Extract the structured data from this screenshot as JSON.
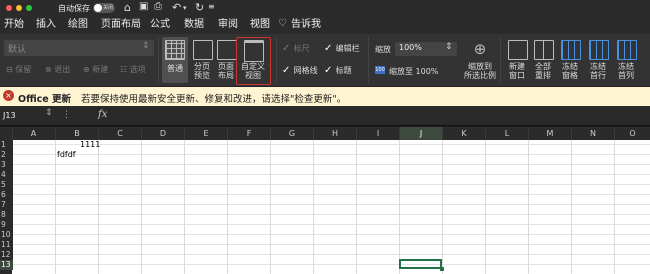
{
  "titlebar": {
    "autosave_label": "自动保存",
    "autosave_toggle_text": "关闭"
  },
  "menu": {
    "items": [
      "开始",
      "插入",
      "绘图",
      "页面布局",
      "公式",
      "数据",
      "审阅",
      "视图"
    ],
    "active": "视图",
    "tell_me": "告诉我"
  },
  "ribbon": {
    "sheet_view_select": "默认",
    "sheet_view_buttons": [
      "保留",
      "退出",
      "新建",
      "选项"
    ],
    "views": [
      {
        "label1": "普通",
        "label2": ""
      },
      {
        "label1": "分页",
        "label2": "预览"
      },
      {
        "label1": "页面",
        "label2": "布局"
      },
      {
        "label1": "自定义",
        "label2": "视图"
      }
    ],
    "show": [
      {
        "label": "标尺",
        "checked": true,
        "enabled": false
      },
      {
        "label": "编辑栏",
        "checked": true,
        "enabled": true
      },
      {
        "label": "网格线",
        "checked": true,
        "enabled": true
      },
      {
        "label": "标题",
        "checked": true,
        "enabled": true
      }
    ],
    "zoom_label": "缩放",
    "zoom_value": "100%",
    "zoom_100_label": "缩放至 100%",
    "zoom_to_selection": {
      "label1": "缩放到",
      "label2": "所选比例"
    },
    "window_buttons": [
      {
        "label1": "新建",
        "label2": "窗口"
      },
      {
        "label1": "全部",
        "label2": "重排"
      },
      {
        "label1": "冻结",
        "label2": "窗格"
      },
      {
        "label1": "冻结",
        "label2": "首行"
      },
      {
        "label1": "冻结",
        "label2": "首列"
      }
    ]
  },
  "message_bar": {
    "title": "Office 更新",
    "text": "若要保持使用最新安全更新、修复和改进，请选择\"检查更新\"。"
  },
  "formula_bar": {
    "name_box": "J13",
    "fx": "fx",
    "formula": ""
  },
  "sheet": {
    "columns": [
      "A",
      "B",
      "C",
      "D",
      "E",
      "F",
      "G",
      "H",
      "I",
      "J",
      "K",
      "L",
      "M",
      "N",
      "O"
    ],
    "rows": [
      "1",
      "2",
      "3",
      "4",
      "5",
      "6",
      "7",
      "8",
      "9",
      "10",
      "11",
      "12",
      "13"
    ],
    "selected_col": "J",
    "selected_row": "13",
    "cells": {
      "B1": "1111",
      "B2": "fdfdf"
    }
  }
}
